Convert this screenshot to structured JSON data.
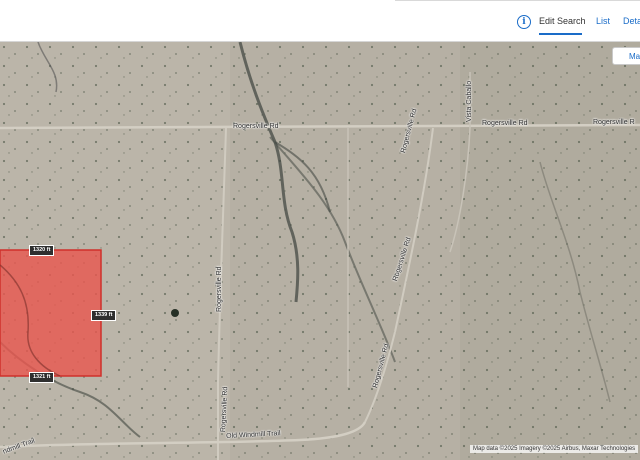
{
  "header": {
    "tabs": [
      {
        "label": "Edit Search",
        "active": true
      },
      {
        "label": "List",
        "active": false
      },
      {
        "label": "Deta",
        "active": false
      }
    ],
    "info_icon": "info-icon"
  },
  "map": {
    "button_label": "Ma",
    "roads": {
      "rogersville_left": "Rogersville Rd",
      "rogersville_mid": "Rogersville Rd",
      "rogersville_right": "Rogersville R",
      "rogersville_diag_top": "Rogersville Rd",
      "rogersville_diag_mid": "Rogersville Rd",
      "rogersville_diag_low": "Rogersville Rd",
      "rogersville_vert_upper": "Rogersville Rd",
      "rogersville_vert_lower": "Rogersville Rd",
      "vista_caballo": "Vista Caballo",
      "old_windmill": "Old Windmill Trail",
      "windmill_left": "ndmill Trail"
    },
    "dimensions": {
      "top": "1320 ft",
      "right": "1339 ft",
      "bottom": "1321 ft"
    },
    "attribution": "Map data ©2025 Imagery ©2025 Airbus, Maxar Technologies",
    "colors": {
      "parcel_fill": "#e8584f",
      "parcel_stroke": "#d0302a",
      "link": "#1a6cc8"
    }
  }
}
